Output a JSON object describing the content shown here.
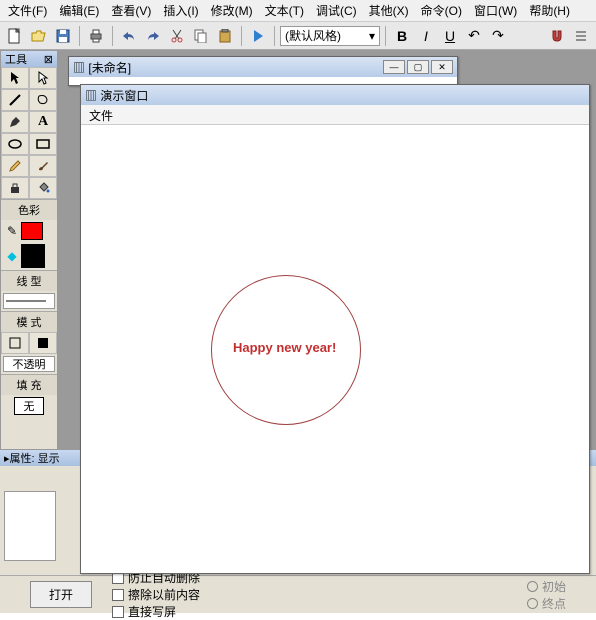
{
  "menu": [
    "文件(F)",
    "编辑(E)",
    "查看(V)",
    "插入(I)",
    "修改(M)",
    "文本(T)",
    "调试(C)",
    "其他(X)",
    "命令(O)",
    "窗口(W)",
    "帮助(H)"
  ],
  "style_dropdown": "(默认风格)",
  "toolbox": {
    "title": "工具",
    "labels": {
      "color": "色彩",
      "line": "线 型",
      "mode": "模 式",
      "opacity": "不透明",
      "fill": "填 充",
      "fill_none": "无"
    }
  },
  "documents": {
    "unnamed": "[未命名]",
    "demo_title": "演示窗口",
    "demo_menu": "文件"
  },
  "canvas_text": "Happy new year!",
  "properties": {
    "title": "属性: 显示"
  },
  "bottom": {
    "open": "打开",
    "chk1_partial": "防止自动删除",
    "chk2": "擦除以前内容",
    "chk3": "直接写屏",
    "radio1": "初始",
    "radio2": "终点"
  }
}
